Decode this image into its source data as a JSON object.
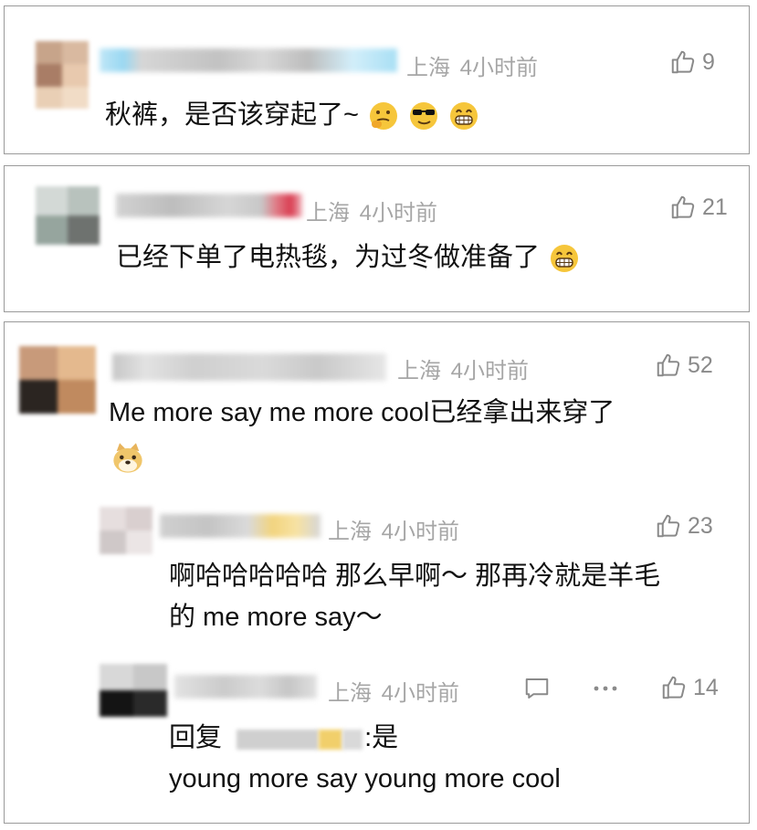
{
  "comments": [
    {
      "location": "上海",
      "time": "4小时前",
      "likes": "9",
      "text": "秋裤，是否该穿起了~",
      "emojis": [
        "thinking-emoji",
        "sunglasses-emoji",
        "grin-emoji"
      ]
    },
    {
      "location": "上海",
      "time": "4小时前",
      "likes": "21",
      "text": "已经下单了电热毯，为过冬做准备了",
      "emojis": [
        "grin-emoji"
      ]
    },
    {
      "location": "上海",
      "time": "4小时前",
      "likes": "52",
      "text": "Me more say me more cool已经拿出来穿了",
      "emojis": [
        "doge-emoji"
      ],
      "replies": [
        {
          "location": "上海",
          "time": "4小时前",
          "likes": "23",
          "text_line1": "啊哈哈哈哈哈 那么早啊～ 那再冷就是羊毛",
          "text_line2": "的 me more say～"
        },
        {
          "location": "上海",
          "time": "4小时前",
          "likes": "14",
          "reply_prefix": "回复",
          "reply_suffix": ":是",
          "text_line2": "young more say young more cool"
        }
      ]
    }
  ],
  "icons": {
    "like": "thumb-up-icon",
    "comment": "comment-bubble-icon",
    "more": "more-dots-icon"
  },
  "colors": {
    "meta_gray": "#a6a6a6",
    "border": "#9a9a9a",
    "emoji_yellow": "#f6c63b"
  }
}
